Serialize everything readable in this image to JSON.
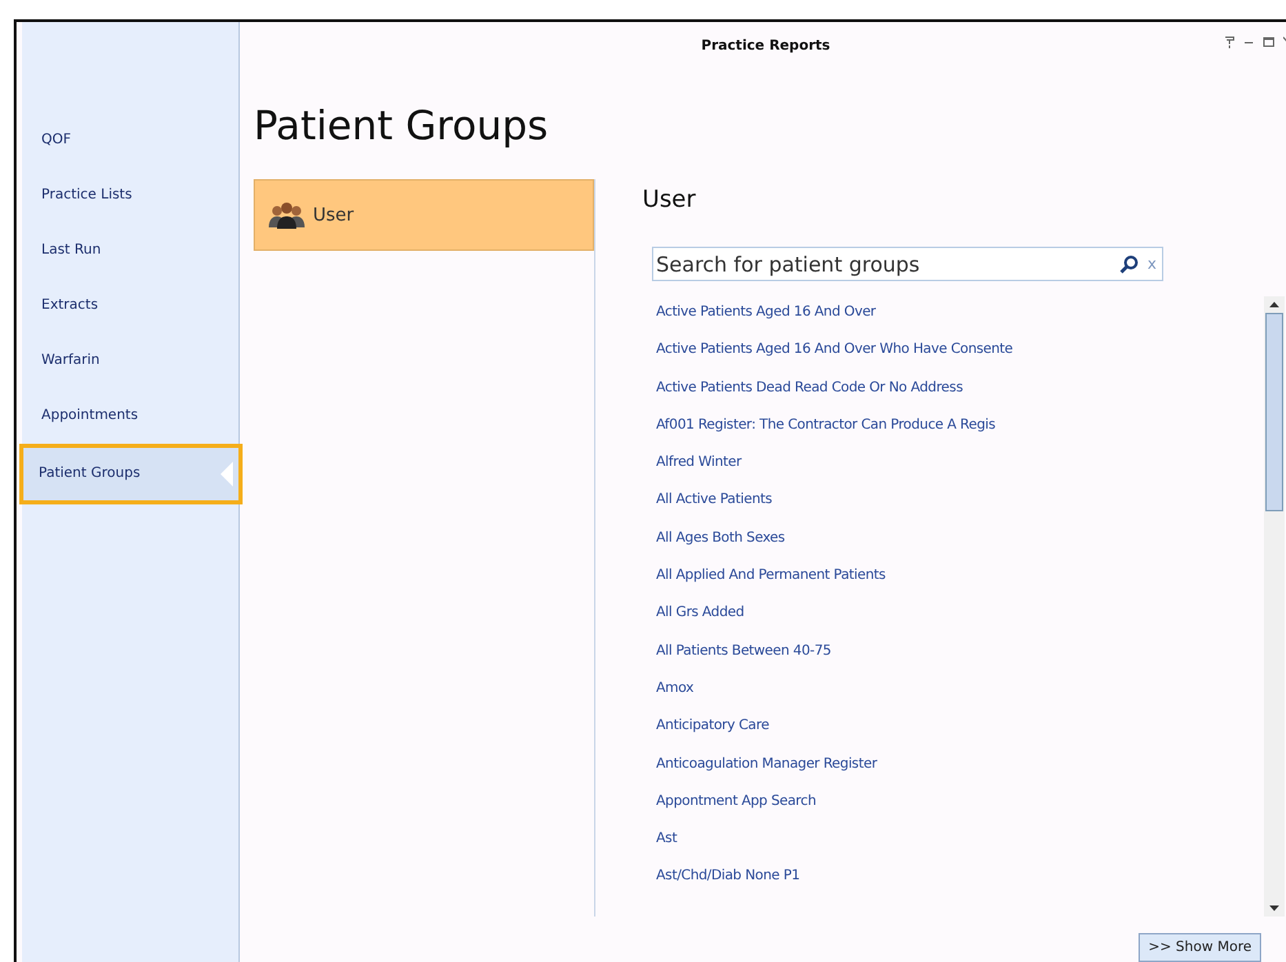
{
  "window": {
    "title": "Practice Reports"
  },
  "sidebar": {
    "items": [
      {
        "label": "QOF",
        "selected": false
      },
      {
        "label": "Practice Lists",
        "selected": false
      },
      {
        "label": "Last Run",
        "selected": false
      },
      {
        "label": "Extracts",
        "selected": false
      },
      {
        "label": "Warfarin",
        "selected": false
      },
      {
        "label": "Appointments",
        "selected": false
      },
      {
        "label": "Patient Groups",
        "selected": true
      }
    ]
  },
  "page_title": "Patient Groups",
  "categories": [
    {
      "label": "User",
      "selected": true
    }
  ],
  "section_title": "User",
  "search": {
    "placeholder": "Search for patient groups",
    "clear": "x"
  },
  "groups": [
    "Active Patients Aged 16 And Over",
    "Active Patients Aged 16 And Over Who Have Consente",
    "Active Patients Dead Read Code Or No Address",
    "Af001 Register: The Contractor Can Produce A Regis",
    "Alfred Winter",
    "All Active Patients",
    "All Ages Both Sexes",
    "All Applied And Permanent Patients",
    "All Grs Added",
    "All Patients Between 40-75",
    "Amox",
    "Anticipatory Care",
    "Anticoagulation Manager Register",
    "Appontment App Search",
    "Ast",
    "Ast/Chd/Diab None P1"
  ],
  "show_more": ">> Show More"
}
